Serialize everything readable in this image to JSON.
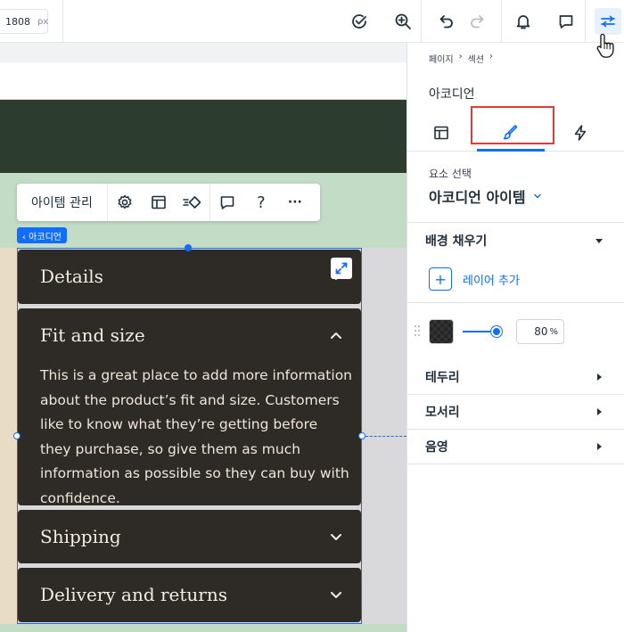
{
  "toolbar": {
    "width_value": "1808",
    "width_unit": "px",
    "icons": [
      "check-circle-icon",
      "zoom-in-icon",
      "undo-icon",
      "redo-icon",
      "bell-icon",
      "comment-icon",
      "sliders-icon"
    ]
  },
  "floating_toolbar": {
    "manage_items": "아이템 관리",
    "help": "?",
    "more": "···"
  },
  "accordion_tag": "‹ 아코디언",
  "accordion": {
    "items": [
      {
        "title": "Details",
        "expanded": false
      },
      {
        "title": "Fit and size",
        "expanded": true,
        "body": "This is a great place to add more information about the product’s fit and size. Customers like to know what they’re getting before they purchase, so give them as much information as possible so they can buy with confidence."
      },
      {
        "title": "Shipping",
        "expanded": false
      },
      {
        "title": "Delivery and returns",
        "expanded": false
      }
    ]
  },
  "panel": {
    "breadcrumb": [
      "페이지",
      "›",
      "섹션",
      "›"
    ],
    "title": "아코디언",
    "tabs": [
      "layout",
      "design",
      "interactions"
    ],
    "active_tab": "design",
    "select_label": "요소 선택",
    "select_value": "아코디언 아이템",
    "fill": {
      "label": "배경 채우기",
      "add_layer": "레이어 추가",
      "opacity_value": "80",
      "opacity_unit": "%"
    },
    "sections": [
      "테두리",
      "모서리",
      "음영"
    ]
  },
  "colors": {
    "accent": "#116dff",
    "highlight": "#e03c3c",
    "accordion_bg": "#2e2a25",
    "accordion_text": "#f3ede3",
    "header_band": "#2c3d2f",
    "section_bg": "#c3dcc6"
  }
}
